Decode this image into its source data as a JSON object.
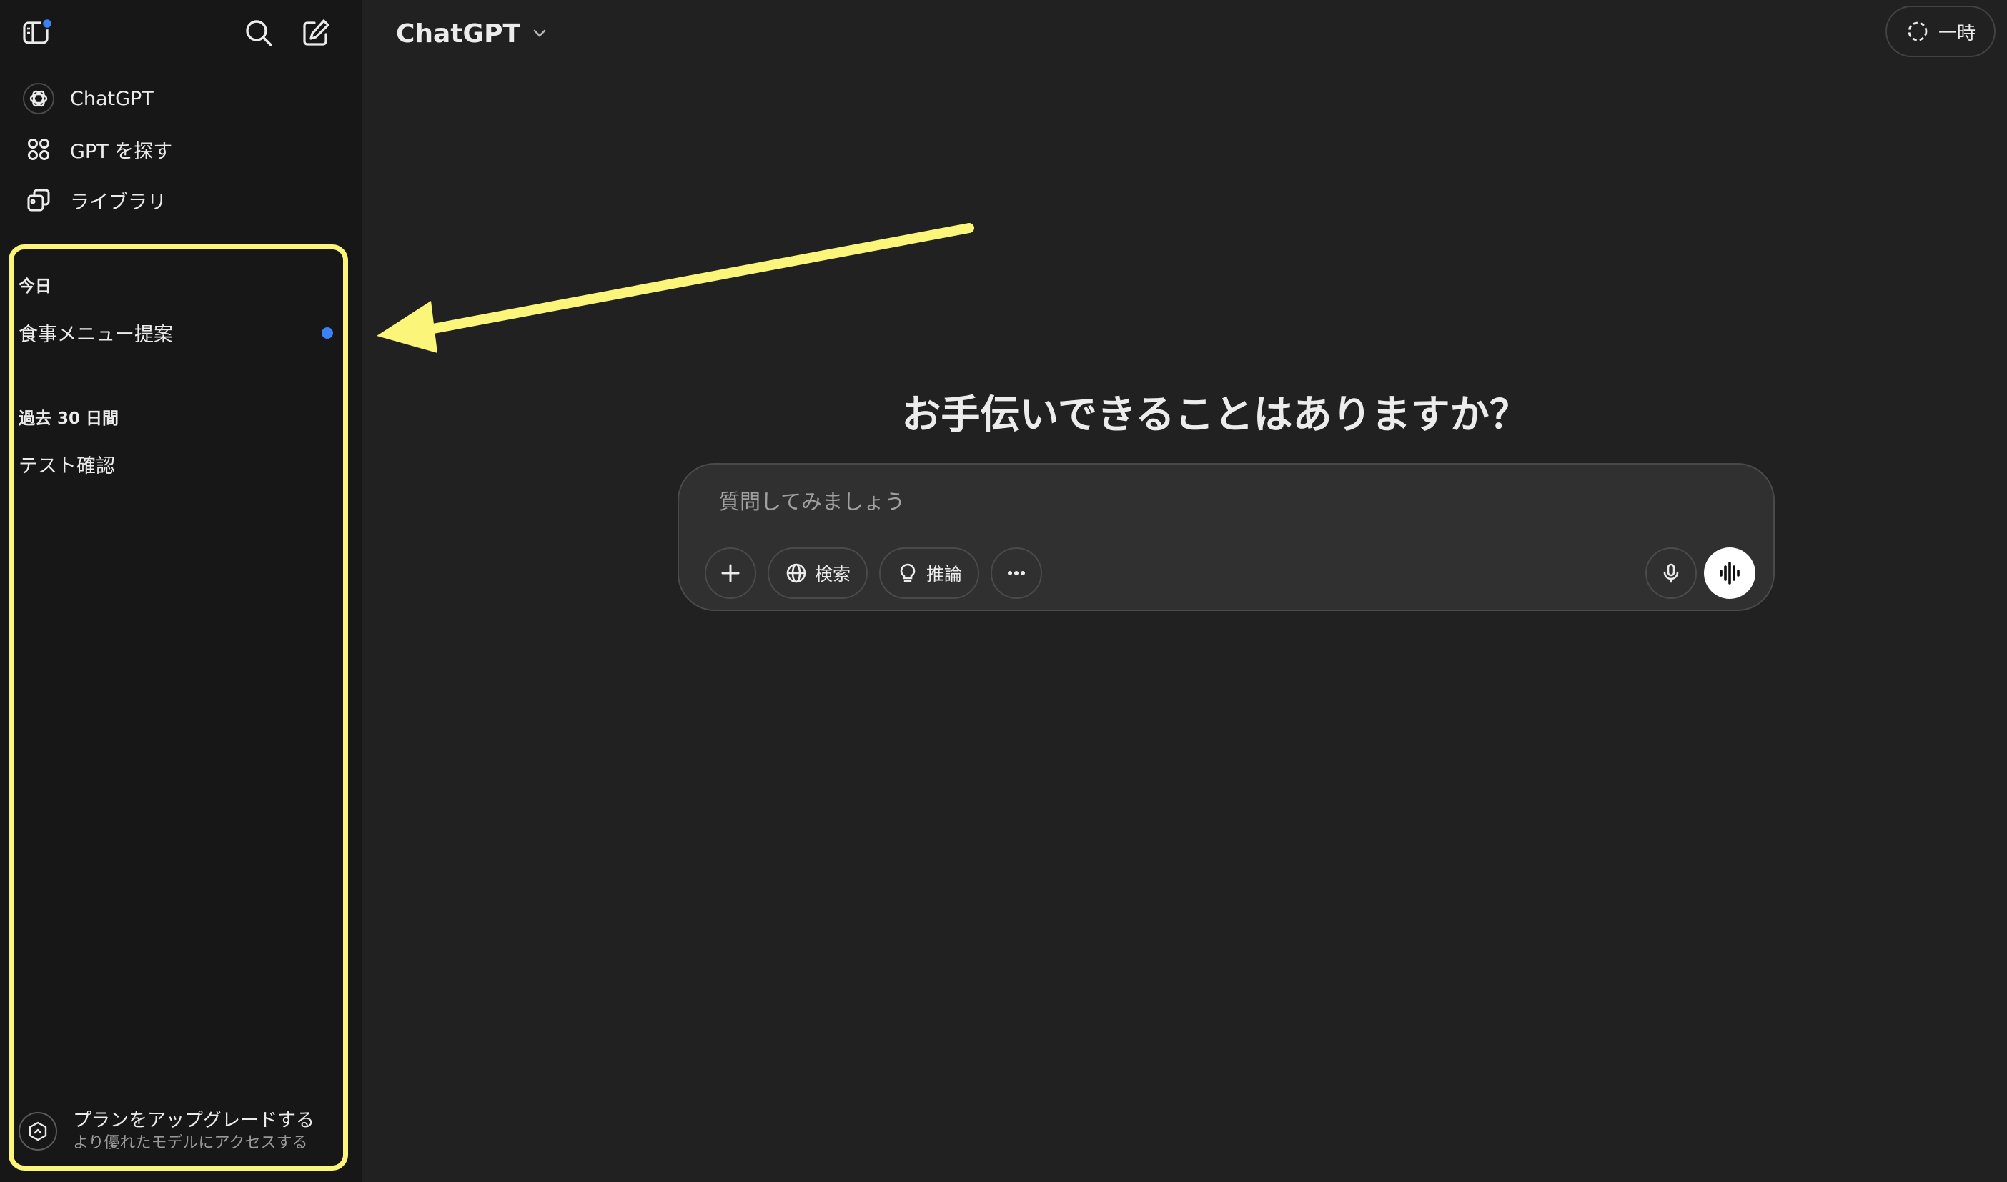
{
  "sidebar": {
    "nav": [
      {
        "label": "ChatGPT",
        "icon": "chatgpt-logo-icon"
      },
      {
        "label": "GPT を探す",
        "icon": "grid-icon"
      },
      {
        "label": "ライブラリ",
        "icon": "library-icon"
      }
    ],
    "sections": [
      {
        "title": "今日",
        "chats": [
          "食事メニュー提案"
        ]
      },
      {
        "title": "過去 30 日間",
        "chats": [
          "テスト確認"
        ]
      }
    ],
    "upgrade": {
      "title": "プランをアップグレードする",
      "subtitle": "より優れたモデルにアクセスする"
    }
  },
  "header": {
    "model_name": "ChatGPT",
    "temporary_label": "一時"
  },
  "main": {
    "headline": "お手伝いできることはありますか？",
    "composer": {
      "placeholder": "質問してみましょう",
      "search_label": "検索",
      "reason_label": "推論"
    }
  },
  "colors": {
    "sidebar_bg": "#171717",
    "main_bg": "#212121",
    "highlight": "#fbf57a",
    "unread_dot": "#3b82f6"
  }
}
